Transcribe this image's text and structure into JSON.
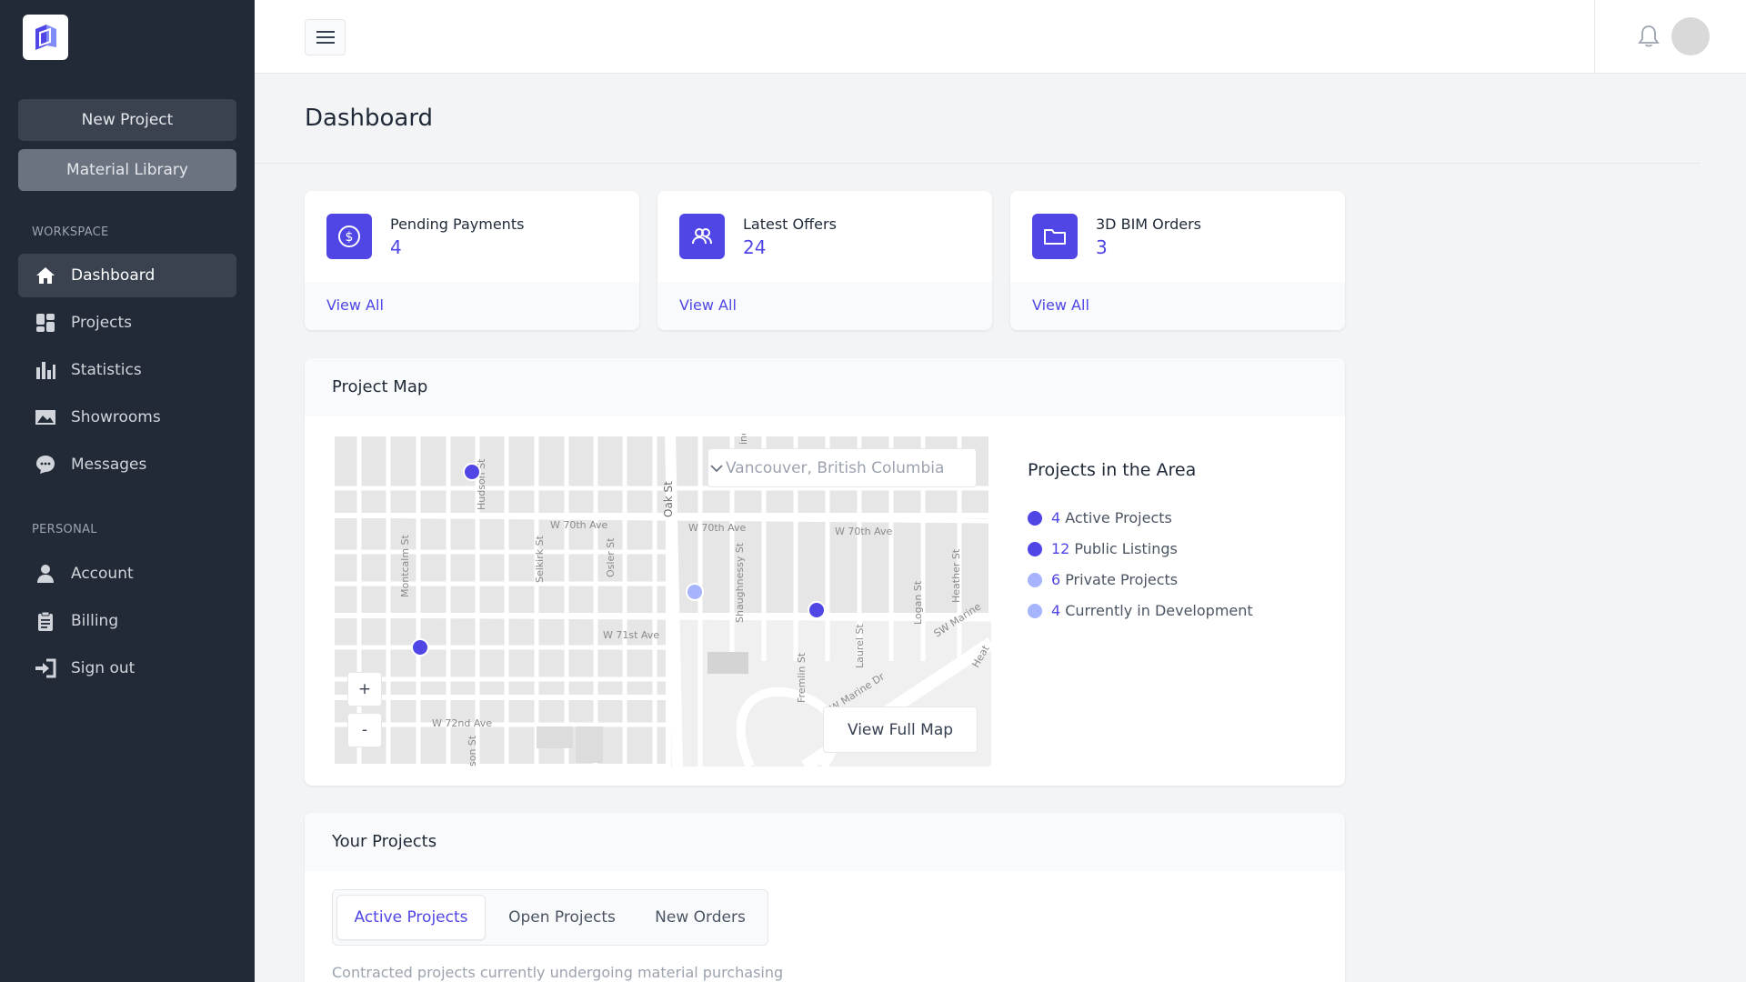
{
  "sidebar": {
    "logo_icon": "cube-logo-icon",
    "new_project": "New Project",
    "material_library": "Material Library",
    "workspace_label": "WORKSPACE",
    "personal_label": "PERSONAL",
    "workspace_items": [
      {
        "label": "Dashboard",
        "icon": "home-icon"
      },
      {
        "label": "Projects",
        "icon": "grid-icon"
      },
      {
        "label": "Statistics",
        "icon": "bar-chart-icon"
      },
      {
        "label": "Showrooms",
        "icon": "image-icon"
      },
      {
        "label": "Messages",
        "icon": "chat-icon"
      }
    ],
    "personal_items": [
      {
        "label": "Account",
        "icon": "user-icon"
      },
      {
        "label": "Billing",
        "icon": "clipboard-icon"
      },
      {
        "label": "Sign out",
        "icon": "sign-out-icon"
      }
    ]
  },
  "header": {
    "menu_icon": "hamburger-icon",
    "bell_icon": "bell-icon"
  },
  "page_title": "Dashboard",
  "cards": [
    {
      "label": "Pending Payments",
      "value": "4",
      "link": "View All",
      "icon": "dollar-icon"
    },
    {
      "label": "Latest Offers",
      "value": "24",
      "link": "View All",
      "icon": "users-icon"
    },
    {
      "label": "3D BIM Orders",
      "value": "3",
      "link": "View All",
      "icon": "folder-icon"
    }
  ],
  "map_panel": {
    "title": "Project Map",
    "location": "Vancouver, British Columbia",
    "zoom_in": "+",
    "zoom_out": "-",
    "view_full_map": "View Full Map",
    "streets": [
      "W 70th Ave",
      "W 70th Ave",
      "W 70th Ave",
      "W 71st Ave",
      "W 72nd Ave",
      "SW Marine Dr",
      "SW Marine",
      "Oak St",
      "Hudson St",
      "Montcalm St",
      "Selkirk St",
      "Osler St",
      "Shaughnessy St",
      "Fremlin St",
      "Laurel St",
      "Logan St",
      "Heather St",
      "son St",
      "Heat",
      "ine"
    ],
    "area": {
      "title": "Projects in the Area",
      "items": [
        {
          "count": "4",
          "label": "Active Projects",
          "color": "#4f46e5"
        },
        {
          "count": "12",
          "label": "Public Listings",
          "color": "#4f46e5"
        },
        {
          "count": "6",
          "label": "Private Projects",
          "color": "#a5b4fc"
        },
        {
          "count": "4",
          "label": "Currently in Development",
          "color": "#a5b4fc"
        }
      ]
    }
  },
  "projects_panel": {
    "title": "Your Projects",
    "tabs": [
      "Active Projects",
      "Open Projects",
      "New Orders"
    ],
    "description": "Contracted projects currently undergoing material purchasing"
  },
  "colors": {
    "accent": "#4f46e5",
    "accent_light": "#a5b4fc",
    "sidebar": "#222a37"
  }
}
